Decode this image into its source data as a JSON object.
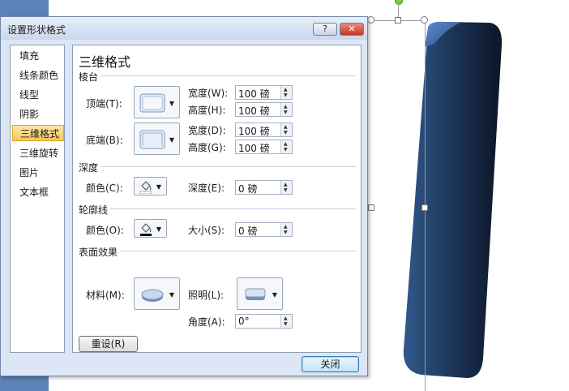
{
  "dialog": {
    "title": "设置形状格式",
    "help_label": "?",
    "close_glyph": "✕",
    "close_button": "关闭",
    "reset_button": "重设(R)"
  },
  "nav": {
    "items": [
      {
        "label": "填充"
      },
      {
        "label": "线条颜色"
      },
      {
        "label": "线型"
      },
      {
        "label": "阴影"
      },
      {
        "label": "三维格式"
      },
      {
        "label": "三维旋转"
      },
      {
        "label": "图片"
      },
      {
        "label": "文本框"
      }
    ],
    "active": "三维格式"
  },
  "panel": {
    "heading": "三维格式",
    "bevel": {
      "title": "棱台",
      "top_label": "顶端(T):",
      "bottom_label": "底端(B):",
      "top_width_label": "宽度(W):",
      "top_width": "100 磅",
      "top_height_label": "高度(H):",
      "top_height": "100 磅",
      "bottom_width_label": "宽度(D):",
      "bottom_width": "100 磅",
      "bottom_height_label": "高度(G):",
      "bottom_height": "100 磅"
    },
    "depth": {
      "title": "深度",
      "color_label": "颜色(C):",
      "depth_label": "深度(E):",
      "depth_value": "0 磅"
    },
    "contour": {
      "title": "轮廓线",
      "color_label": "颜色(O):",
      "size_label": "大小(S):",
      "size_value": "0 磅"
    },
    "surface": {
      "title": "表面效果",
      "material_label": "材料(M):",
      "lighting_label": "照明(L):",
      "angle_label": "角度(A):",
      "angle_value": "0°"
    }
  },
  "colors": {
    "accent_blue": "#5b83b7",
    "shape_dark": "#0f1d31",
    "shape_mid": "#2c4f7d",
    "active_tab": "#f7c65b"
  }
}
